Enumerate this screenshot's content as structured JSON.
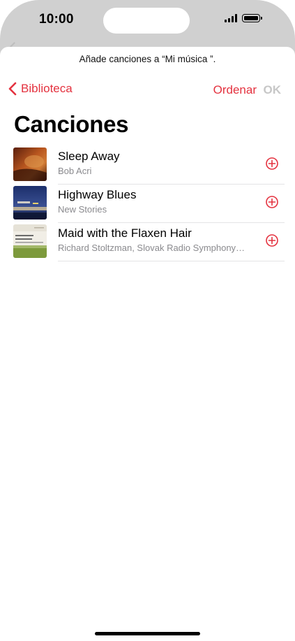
{
  "status_bar": {
    "time": "10:00"
  },
  "sheet": {
    "prompt": "Añade canciones a “Mi música ”."
  },
  "nav": {
    "back_label": "Biblioteca",
    "sort_label": "Ordenar",
    "ok_label": "OK"
  },
  "page": {
    "title": "Canciones"
  },
  "songs": [
    {
      "title": "Sleep Away",
      "artist": "Bob Acri"
    },
    {
      "title": "Highway Blues",
      "artist": "New Stories"
    },
    {
      "title": "Maid with the Flaxen Hair",
      "artist": "Richard Stoltzman, Slovak Radio Symphony…"
    }
  ],
  "colors": {
    "accent": "#e4323f",
    "disabled": "#c7c7c7",
    "secondary_text": "#8a8a8e"
  }
}
